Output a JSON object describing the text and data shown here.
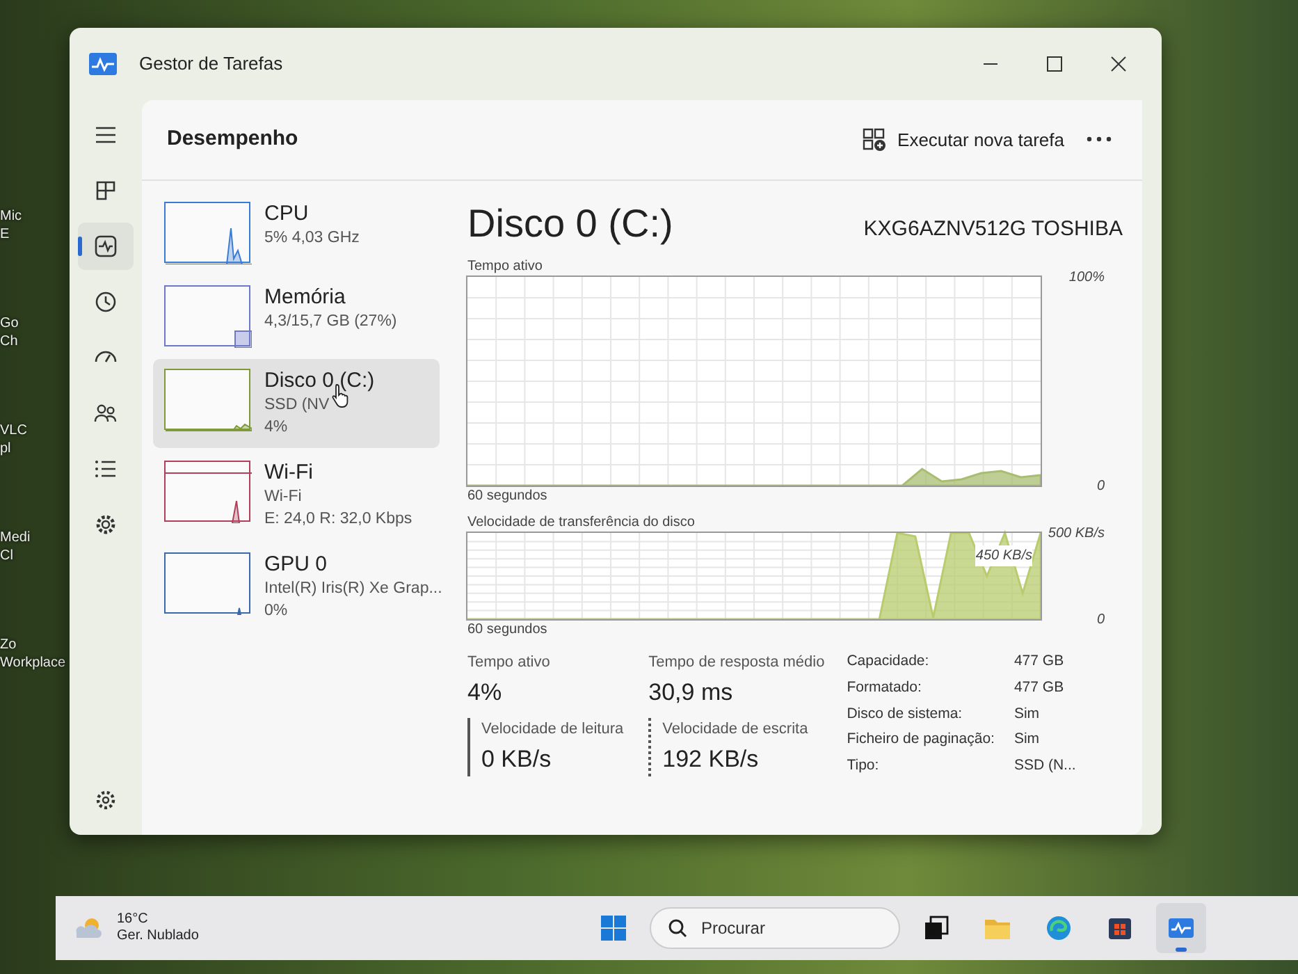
{
  "desktop_icons": [
    {
      "lines": [
        "Mic",
        "E"
      ]
    },
    {
      "lines": [
        "Go",
        "Ch"
      ]
    },
    {
      "lines": [
        "VLC",
        "pl"
      ]
    },
    {
      "lines": [
        "Medi",
        "Cl"
      ]
    },
    {
      "lines": [
        "Zo",
        "Workplace"
      ]
    }
  ],
  "window": {
    "title": "Gestor de Tarefas"
  },
  "nav_rail": [
    {
      "selected": false
    },
    {
      "selected": false
    },
    {
      "selected": true
    },
    {
      "selected": false
    },
    {
      "selected": false
    },
    {
      "selected": false
    },
    {
      "selected": false
    },
    {
      "selected": false
    },
    {
      "selected": false
    }
  ],
  "page": {
    "title": "Desempenho",
    "run_task_button": "Executar nova tarefa"
  },
  "devices": [
    {
      "name": "CPU",
      "lines": [
        "5% 4,03 GHz"
      ],
      "color": "#3a7bd5",
      "selected": false
    },
    {
      "name": "Memória",
      "lines": [
        "4,3/15,7 GB (27%)"
      ],
      "color": "#6e78c8",
      "selected": false
    },
    {
      "name": "Disco 0 (C:)",
      "lines": [
        "SSD (NV",
        "4%"
      ],
      "color": "#7e9a3a",
      "selected": true
    },
    {
      "name": "Wi-Fi",
      "lines": [
        "Wi-Fi",
        "E: 24,0 R: 32,0 Kbps"
      ],
      "color": "#b0405a",
      "selected": false
    },
    {
      "name": "GPU 0",
      "lines": [
        "Intel(R) Iris(R) Xe Grap...",
        "0%"
      ],
      "color": "#3a6aa8",
      "selected": false
    }
  ],
  "detail": {
    "title": "Disco 0 (C:)",
    "model": "KXG6AZNV512G TOSHIBA",
    "charts": [
      {
        "chart_data": {
          "type": "area",
          "title": "Tempo ativo",
          "xlabel": "60 segundos",
          "grid": true,
          "ylim": [
            0,
            100
          ],
          "yticks": [
            {
              "value": 0,
              "label": "0"
            },
            {
              "value": 100,
              "label": "100%"
            }
          ],
          "series": [
            {
              "color": "#a9bd72",
              "values": [
                0,
                0,
                0,
                0,
                0,
                0,
                0,
                0,
                0,
                0,
                0,
                0,
                0,
                0,
                0,
                0,
                0,
                0,
                0,
                0,
                0,
                0,
                0,
                8,
                2,
                3,
                6,
                7,
                4,
                5
              ]
            }
          ]
        }
      },
      {
        "chart_data": {
          "type": "area",
          "title": "Velocidade de transferência do disco",
          "xlabel": "60 segundos",
          "grid": true,
          "ylim": [
            0,
            500
          ],
          "yticks": [
            {
              "value": 0,
              "label": "0"
            },
            {
              "value": 500,
              "label": "500 KB/s"
            }
          ],
          "series": [
            {
              "color": "#b8cc6e",
              "values": [
                0,
                0,
                0,
                0,
                0,
                0,
                0,
                0,
                0,
                0,
                0,
                0,
                0,
                0,
                0,
                0,
                0,
                0,
                0,
                0,
                0,
                0,
                0,
                0,
                500,
                480,
                10,
                500,
                500,
                250,
                500,
                150,
                500
              ]
            }
          ]
        },
        "overlay_label": "450 KB/s"
      }
    ],
    "stats": [
      {
        "label": "Tempo ativo",
        "value": "4%",
        "kind": "plain"
      },
      {
        "label": "Tempo de resposta médio",
        "value": "30,9 ms",
        "kind": "plain"
      },
      {
        "label": "Velocidade de leitura",
        "value": "0 KB/s",
        "kind": "solid"
      },
      {
        "label": "Velocidade de escrita",
        "value": "192 KB/s",
        "kind": "dotted"
      }
    ],
    "properties": [
      {
        "label": "Capacidade:",
        "value": "477 GB"
      },
      {
        "label": "Formatado:",
        "value": "477 GB"
      },
      {
        "label": "Disco de sistema:",
        "value": "Sim"
      },
      {
        "label": "Ficheiro de paginação:",
        "value": "Sim"
      },
      {
        "label": "Tipo:",
        "value": "SSD (N..."
      }
    ]
  },
  "taskbar": {
    "weather": {
      "temperature": "16°C",
      "condition": "Ger. Nublado"
    },
    "search": {
      "placeholder": "Procurar"
    },
    "apps": [
      {
        "active": false
      },
      {
        "active": false
      },
      {
        "active": false
      },
      {
        "active": false
      },
      {
        "active": true
      }
    ]
  }
}
